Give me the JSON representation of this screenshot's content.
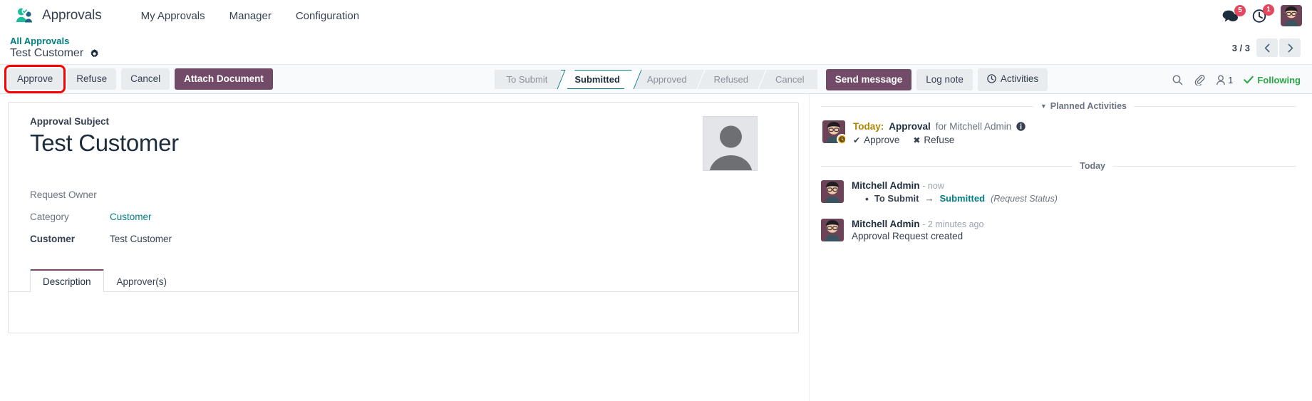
{
  "navbar": {
    "app_logo_icon": "approvals-people-icon",
    "app_name": "Approvals",
    "menu": [
      {
        "label": "My Approvals",
        "name": "nav-my-approvals"
      },
      {
        "label": "Manager",
        "name": "nav-manager"
      },
      {
        "label": "Configuration",
        "name": "nav-configuration"
      }
    ],
    "messages_icon": "chat-bubble-icon",
    "messages_count": "5",
    "activities_icon": "clock-icon",
    "activities_count": "1",
    "user_avatar_icon": "user-avatar"
  },
  "controlpanel": {
    "breadcrumb_parent": "All Approvals",
    "breadcrumb_current": "Test Customer",
    "gear_icon": "gear-icon",
    "pager_value": "3 / 3",
    "prev_icon": "chevron-left-icon",
    "next_icon": "chevron-right-icon",
    "buttons": [
      {
        "label": "Approve",
        "name": "approve-button",
        "style": "secondary",
        "highlighted": true
      },
      {
        "label": "Refuse",
        "name": "refuse-button",
        "style": "secondary",
        "highlighted": false
      },
      {
        "label": "Cancel",
        "name": "cancel-button",
        "style": "secondary",
        "highlighted": false
      },
      {
        "label": "Attach Document",
        "name": "attach-document-button",
        "style": "primary",
        "highlighted": false
      }
    ],
    "statusbar": [
      {
        "label": "To Submit",
        "active": false
      },
      {
        "label": "Submitted",
        "active": true
      },
      {
        "label": "Approved",
        "active": false
      },
      {
        "label": "Refused",
        "active": false
      },
      {
        "label": "Cancel",
        "active": false
      }
    ],
    "highlight_color": "#fe0000",
    "accent_color": "#714b67",
    "link_color": "#017e84"
  },
  "chatter_bar": {
    "send_message": "Send message",
    "log_note": "Log note",
    "activities": "Activities",
    "activities_icon": "clock-icon",
    "search_icon": "search-icon",
    "attachment_icon": "paperclip-icon",
    "followers_icon": "user-icon",
    "followers_count": "1",
    "following_label": "Following",
    "following_icon": "check-icon",
    "following_color": "#28a745"
  },
  "form": {
    "subject_label": "Approval Subject",
    "subject_value": "Test Customer",
    "avatar_icon": "placeholder-avatar",
    "fields": [
      {
        "label": "Request Owner",
        "value": "",
        "required": false,
        "link": false,
        "name": "field-request-owner"
      },
      {
        "label": "Category",
        "value": "Customer",
        "required": false,
        "link": true,
        "name": "field-category"
      },
      {
        "label": "Customer",
        "value": "Test Customer",
        "required": true,
        "link": false,
        "name": "field-customer"
      }
    ],
    "tabs": [
      {
        "label": "Description",
        "active": true,
        "name": "tab-description"
      },
      {
        "label": "Approver(s)",
        "active": false,
        "name": "tab-approvers"
      }
    ]
  },
  "chatter": {
    "planned_activities_label": "Planned Activities",
    "caret_icon": "caret-down-icon",
    "activity": {
      "avatar_icon": "user-avatar",
      "badge_icon": "activity-clock-icon",
      "when": "Today:",
      "type": "Approval",
      "assignee_text": "for Mitchell Admin",
      "info_icon": "info-icon",
      "actions": [
        {
          "label": "Approve",
          "mark": "✔",
          "name": "activity-approve-button"
        },
        {
          "label": "Refuse",
          "mark": "✖",
          "name": "activity-refuse-button"
        }
      ]
    },
    "today_divider": "Today",
    "messages": [
      {
        "author": "Mitchell Admin",
        "time": "- now",
        "avatar_icon": "user-avatar",
        "tracking": {
          "from": "To Submit",
          "arrow": "→",
          "to": "Submitted",
          "field": "(Request Status)"
        },
        "text": ""
      },
      {
        "author": "Mitchell Admin",
        "time": "- 2 minutes ago",
        "avatar_icon": "user-avatar",
        "tracking": null,
        "text": "Approval Request created"
      }
    ]
  }
}
